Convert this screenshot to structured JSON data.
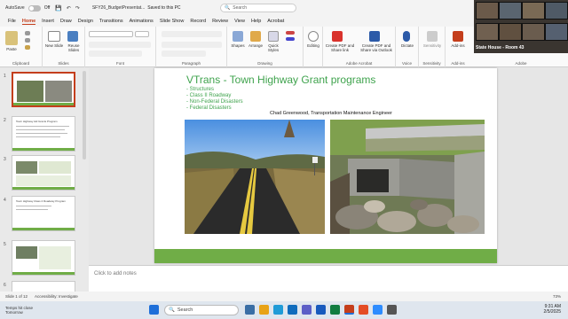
{
  "titlebar": {
    "autosave_label": "AutoSave",
    "autosave_state": "Off",
    "doc_title": "SFY26_BudgetPresentat...",
    "saved_status": "Saved to this PC",
    "search_placeholder": "Search"
  },
  "ribbon_tabs": [
    "File",
    "Home",
    "Insert",
    "Draw",
    "Design",
    "Transitions",
    "Animations",
    "Slide Show",
    "Record",
    "Review",
    "View",
    "Help",
    "Acrobat"
  ],
  "active_tab": "Home",
  "ribbon": {
    "paste": "Paste",
    "new_slide": "New Slide",
    "reuse_slides": "Reuse Slides",
    "shapes": "Shapes",
    "arrange": "Arrange",
    "quick_styles": "Quick Styles",
    "editing": "Editing",
    "create_pdf_share": "Create PDF and Share link",
    "create_pdf_outlook": "Create PDF and Share via Outlook",
    "dictate": "Dictate",
    "sensitivity": "Sensitivity",
    "addins": "Add-ins",
    "groups": [
      "Clipboard",
      "Slides",
      "Font",
      "Paragraph",
      "Drawing",
      "Adobe Acrobat",
      "Voice",
      "Sensitivity",
      "Add-ins",
      "Adobe"
    ]
  },
  "video": {
    "label": "State House - Room 43"
  },
  "thumbnails": [
    {
      "num": "1",
      "selected": true
    },
    {
      "num": "2",
      "title": "Town Highway Aid Grants Program"
    },
    {
      "num": "3"
    },
    {
      "num": "4",
      "title": "Town Highway Class 2 Roadway Program"
    },
    {
      "num": "5"
    },
    {
      "num": "6"
    }
  ],
  "slide": {
    "title": "VTrans - Town Highway Grant programs",
    "bullets": [
      "- Structures",
      "- Class II Roadway",
      "- Non-Federal Disasters",
      "- Federal Disasters"
    ],
    "subtitle": "Chad Greenwood, Transportation Maintenance Engineer"
  },
  "notes_placeholder": "Click to add notes",
  "statusbar": {
    "slide_of": "Slide 1 of 12",
    "accessibility": "Accessibility: Investigate",
    "zoom": "73%"
  },
  "taskbar": {
    "weather_temp": "Temps hit close",
    "weather_sub": "Tomorrow",
    "search": "Search",
    "time": "9:31 AM",
    "date": "2/5/2025"
  },
  "colors": {
    "accent": "#c43e1c",
    "slide_green": "#70ad47",
    "title_green": "#3fa34d"
  }
}
